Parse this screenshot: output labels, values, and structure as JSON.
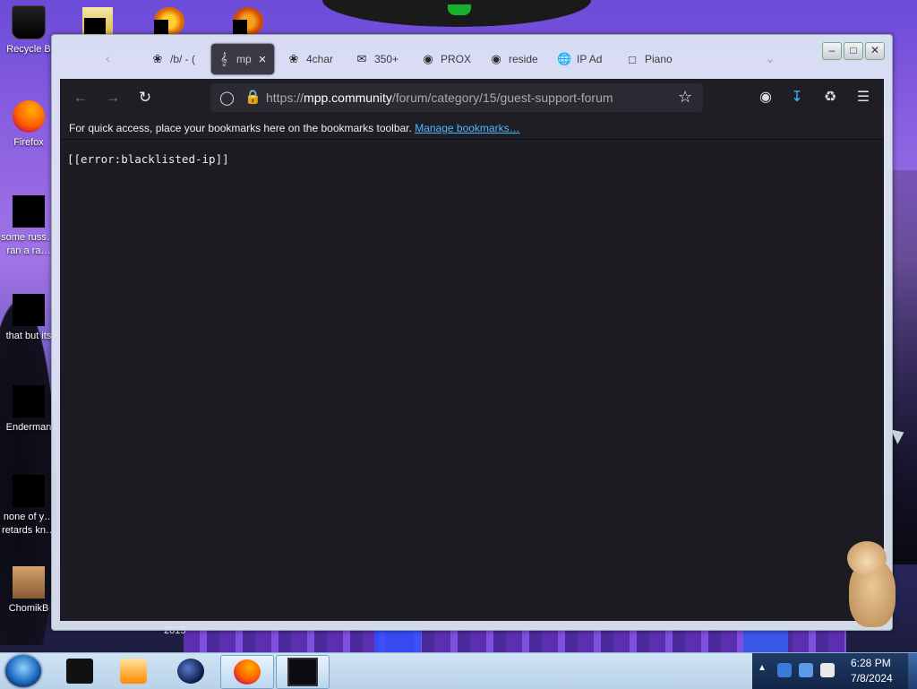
{
  "desktop": {
    "icons": [
      {
        "label": "Recycle B"
      },
      {
        "label": "Firefox"
      },
      {
        "label": "some russ… ran a ra…"
      },
      {
        "label": "that but its"
      },
      {
        "label": "Enderman"
      },
      {
        "label": "none of y… retards kn…"
      },
      {
        "label": "ChomikB"
      }
    ],
    "wallpaper_year": "2015"
  },
  "browser": {
    "tabs": [
      {
        "label": "/b/ - (",
        "icon": "clover-icon"
      },
      {
        "label": "mp",
        "icon": "treble-clef-icon",
        "active": true
      },
      {
        "label": "4char",
        "icon": "clover-icon"
      },
      {
        "label": "350+",
        "icon": "envelope-icon"
      },
      {
        "label": "PROX",
        "icon": "github-icon"
      },
      {
        "label": "reside",
        "icon": "github-icon"
      },
      {
        "label": "IP Ad",
        "icon": "globe-icon"
      },
      {
        "label": "Piano",
        "icon": "page-icon"
      }
    ],
    "url": {
      "scheme": "https://",
      "host": "mpp.community",
      "path": "/forum/category/15/guest-support-forum"
    },
    "bookmarks_toolbar": {
      "text": "For quick access, place your bookmarks here on the bookmarks toolbar.",
      "link": "Manage bookmarks…"
    },
    "page_content": "[[error:blacklisted-ip]]"
  },
  "taskbar": {
    "clock": {
      "time": "6:28 PM",
      "date": "7/8/2024"
    },
    "apps": [
      "window-icon",
      "media-player-icon",
      "globe-app-icon",
      "firefox-icon",
      "terminal-icon"
    ]
  }
}
